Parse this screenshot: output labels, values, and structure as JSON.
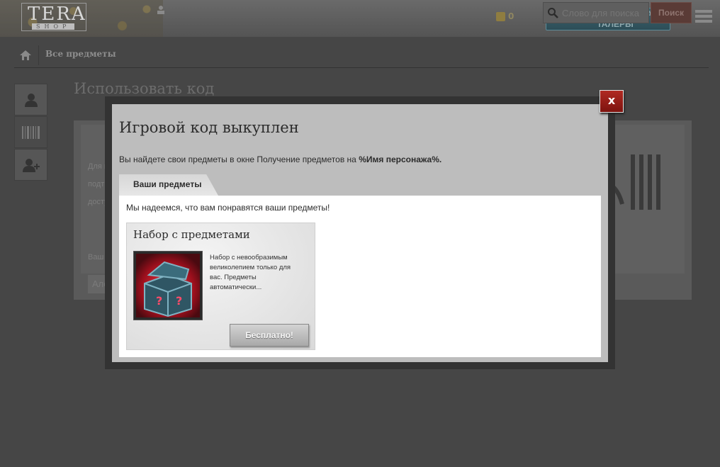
{
  "header": {
    "logo_text": "TERA",
    "logo_sub": "SHOP",
    "coins_count": "0",
    "refresh_label": "ОБНОВИТЬ TERA ТАЛЕРЫ"
  },
  "nav": {
    "all_items": "Все предметы",
    "search_placeholder": "Слово для поиска",
    "search_button": "Поиск"
  },
  "page": {
    "title": "Использовать код",
    "text_line1": "Для п",
    "text_line2": "подтв",
    "text_line3": "досту",
    "label": "Ваш к",
    "input_value": "Але"
  },
  "modal": {
    "title": "Игровой код выкуплен",
    "desc_prefix": "Вы найдете свои предметы в окне Получение предметов на ",
    "desc_bold": "%Имя персонажа%.",
    "close_label": "x",
    "tab_label": "Ваши предметы",
    "message": "Мы надеемся, что вам понравятся ваши предметы!",
    "item": {
      "title": "Набор с предметами",
      "description": "Набор с невообразимым великолепием только для вас. Предметы автоматически...",
      "button": "Бесплатно!"
    }
  },
  "colors": {
    "close_red": "#b02a22",
    "refresh_teal": "#3f6670",
    "background": "#464646"
  }
}
